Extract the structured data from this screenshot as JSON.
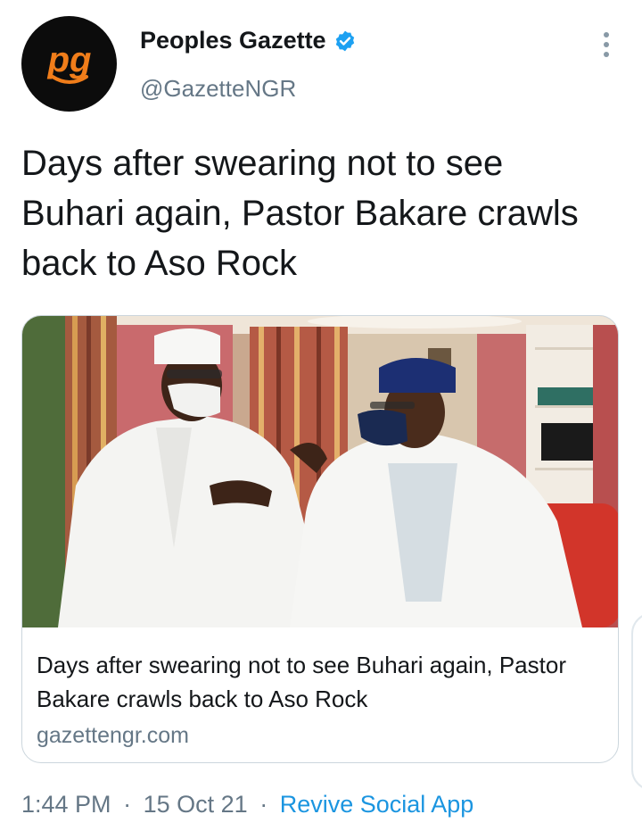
{
  "account": {
    "display_name": "Peoples Gazette",
    "handle": "@GazetteNGR",
    "verified": true,
    "avatar_logo": "pg"
  },
  "tweet": {
    "text": "Days after swearing not to see Buhari again, Pastor Bakare crawls back to Aso Rock"
  },
  "link_card": {
    "title": "Days after swearing not to see Buhari again, Pastor Bakare crawls back to Aso Rock",
    "domain": "gazettengr.com"
  },
  "meta": {
    "time": "1:44 PM",
    "separator": "·",
    "date": "15 Oct 21",
    "source": "Revive Social App"
  },
  "colors": {
    "logo_orange": "#f07d1a",
    "verified_blue": "#1da1f2",
    "link_blue": "#1b95e0",
    "secondary_text": "#657786"
  },
  "icons": {
    "verified": "verified-badge-icon",
    "more": "more-vertical-icon"
  }
}
